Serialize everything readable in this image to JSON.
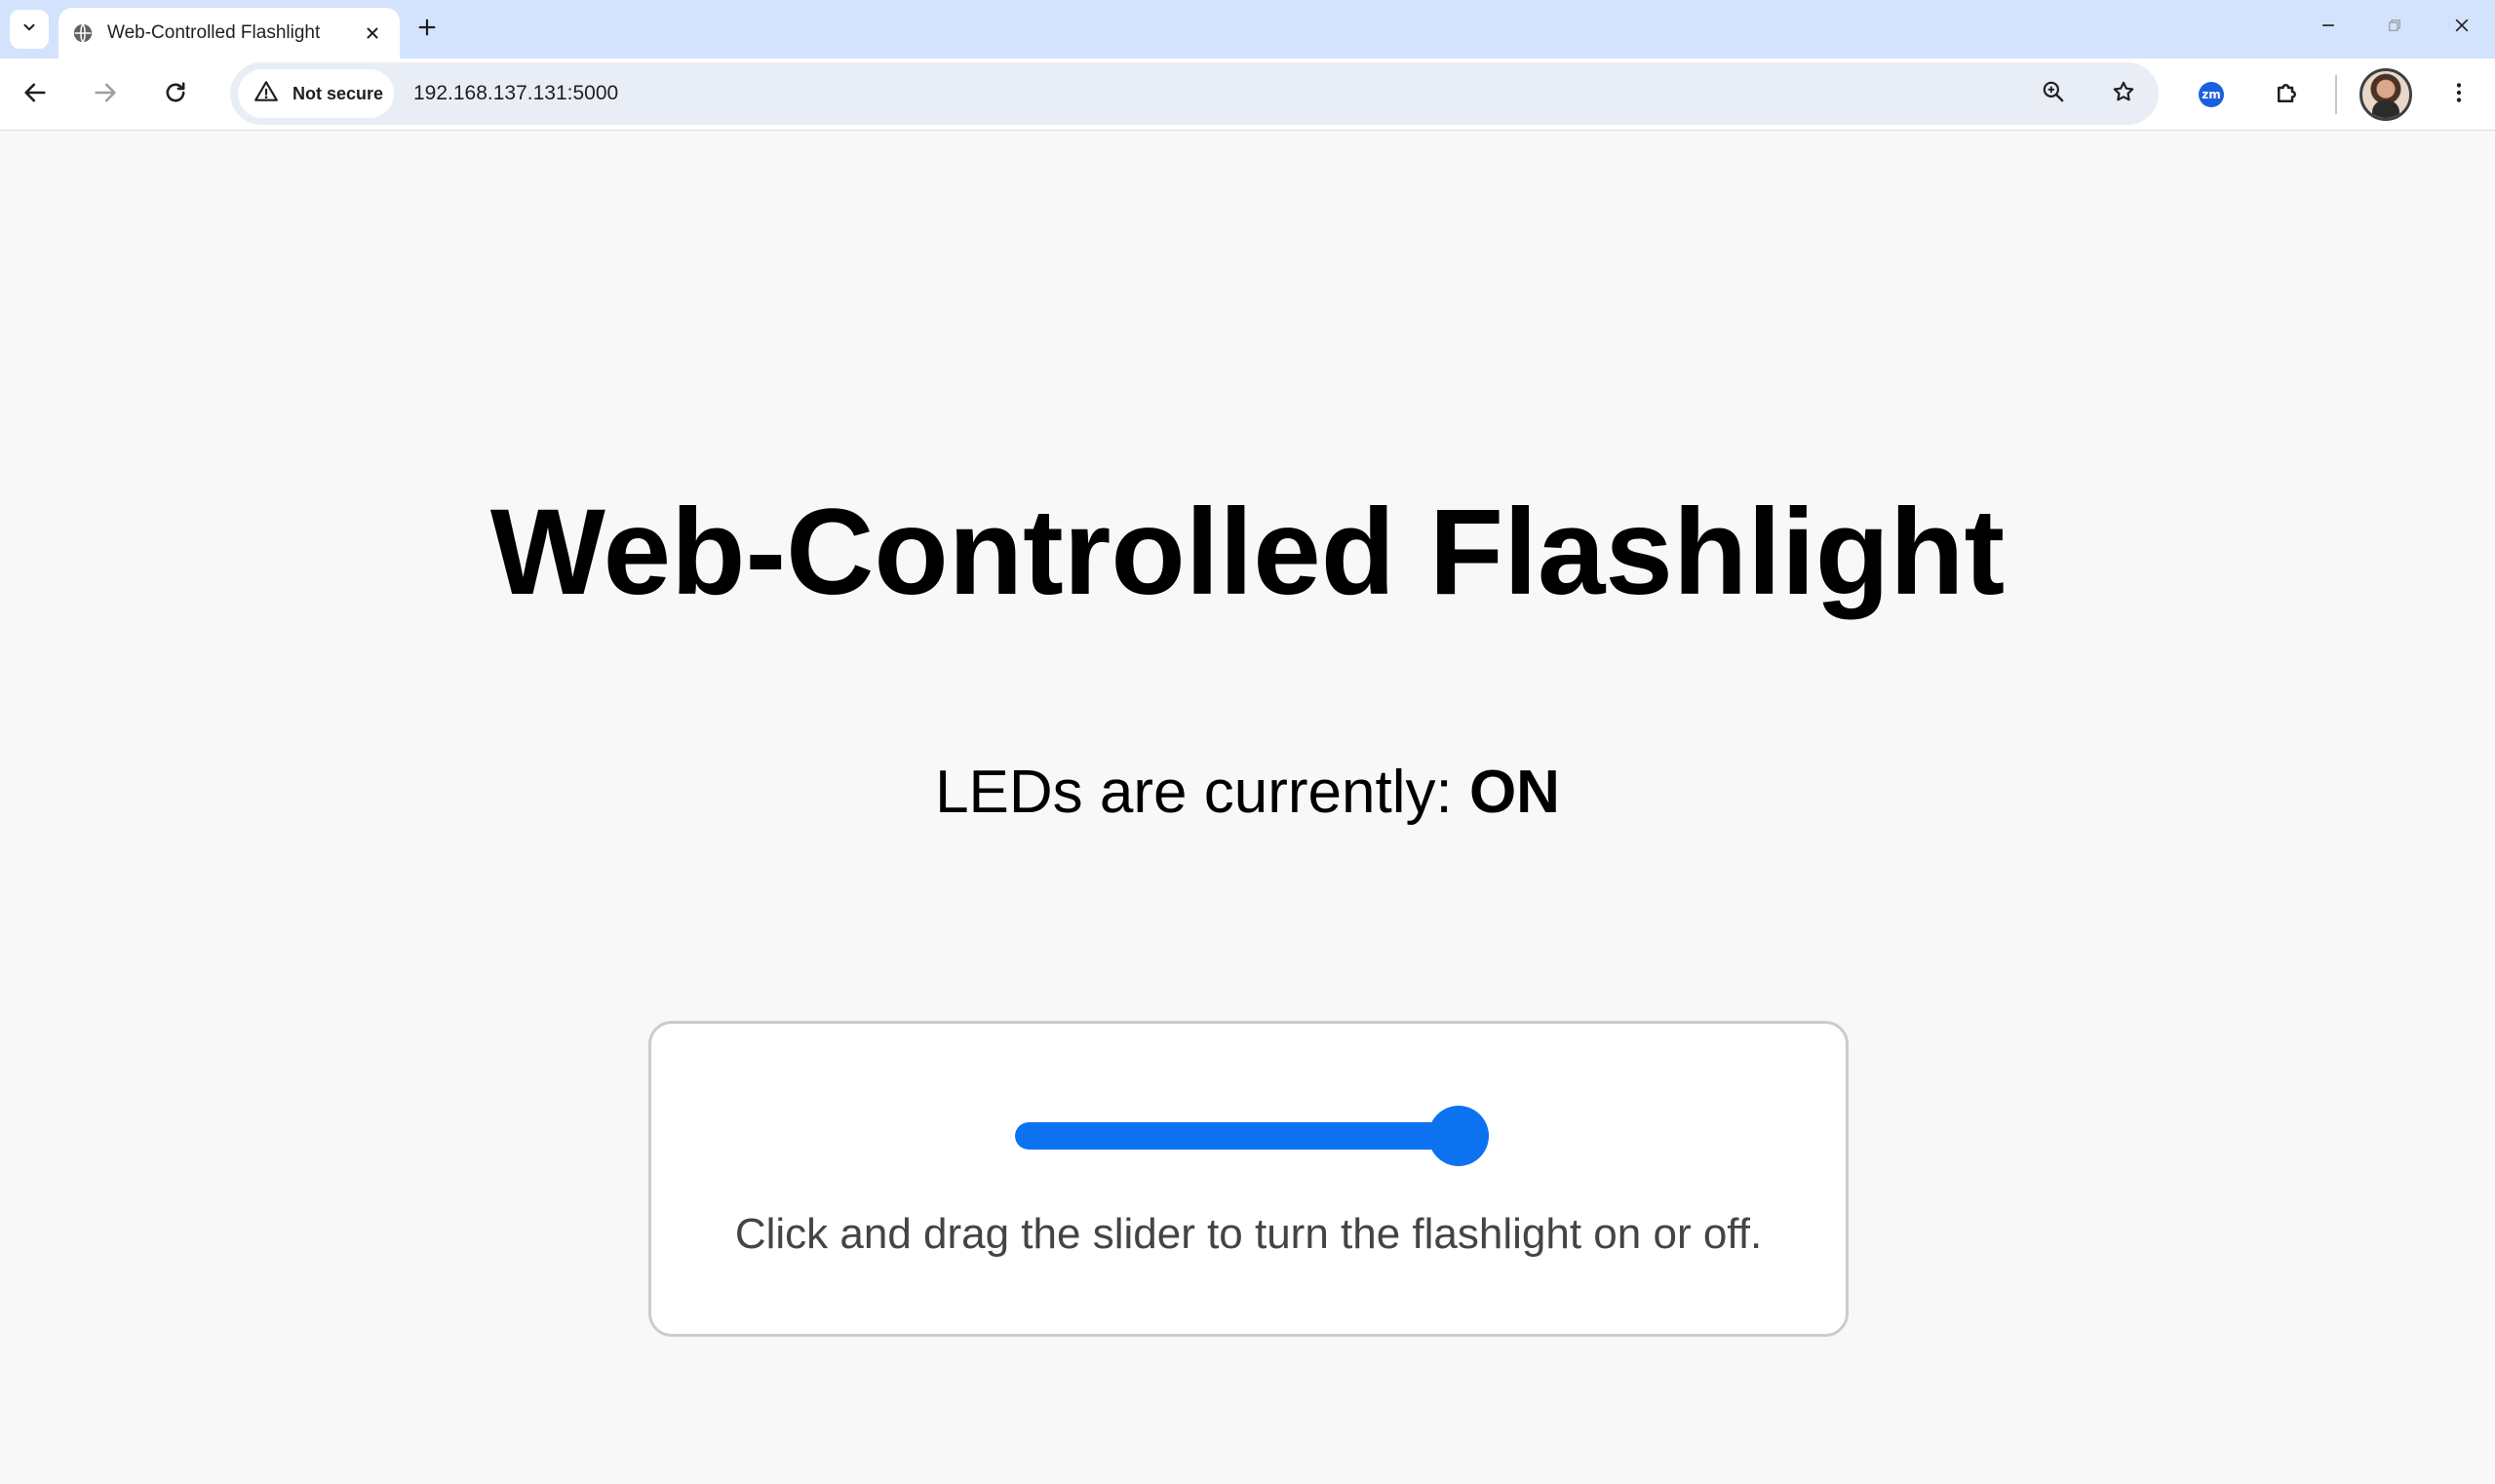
{
  "browser": {
    "tab": {
      "title": "Web-Controlled Flashlight"
    },
    "security_label": "Not secure",
    "url": "192.168.137.131:5000",
    "extension_badge": "zm"
  },
  "page": {
    "heading": "Web-Controlled Flashlight",
    "status_prefix": "LEDs are currently:",
    "status_value": "ON",
    "slider": {
      "value": 1,
      "min": 0,
      "max": 1,
      "accent_color": "#0d72f0"
    },
    "hint": "Click and drag the slider to turn the flashlight on or off."
  }
}
